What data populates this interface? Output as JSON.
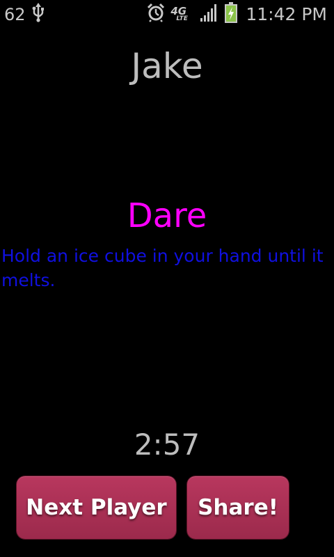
{
  "status_bar": {
    "notification_count": "62",
    "icons": [
      "usb-icon",
      "alarm-icon",
      "4g-lte-icon",
      "signal-icon",
      "battery-charging-icon"
    ],
    "network_label": "4G",
    "network_sub_label": "LTE",
    "time": "11:42 PM"
  },
  "game": {
    "player_name": "Jake",
    "card_type": "Dare",
    "card_text": "Hold an ice cube in your hand until it melts.",
    "timer": "2:57"
  },
  "buttons": {
    "next_player": "Next Player",
    "share": "Share!"
  },
  "colors": {
    "background": "#000000",
    "player_name": "#bdbdbd",
    "card_type": "#ff00ff",
    "card_text": "#1010e0",
    "button": "#a93055",
    "battery_green": "#8bc34a"
  }
}
